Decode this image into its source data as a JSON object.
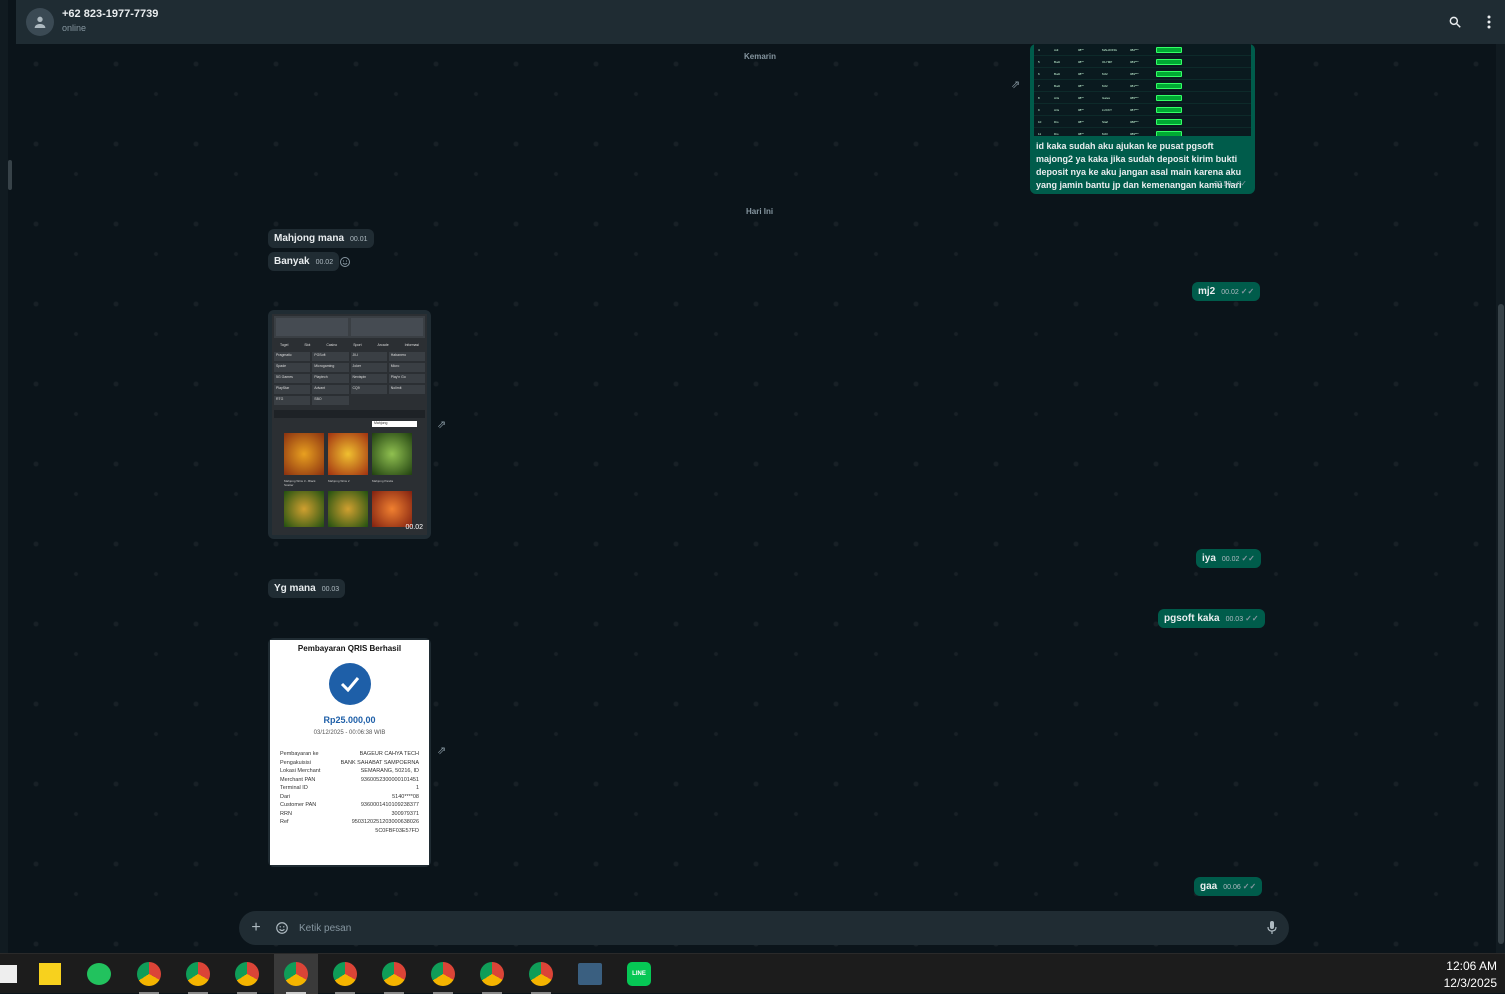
{
  "header": {
    "contact_name": "+62 823-1977-7739",
    "status": "online",
    "search_icon": "search-icon",
    "menu_icon": "kebab-menu-icon"
  },
  "dates": {
    "yesterday": "Kemarin",
    "today": "Hari Ini"
  },
  "messages": {
    "out_caption": {
      "text": "id kaka sudah aku ajukan ke pusat pgsoft majong2 ya kaka jika sudah deposit kirim bukti deposit nya ke aku jangan asal main karena aku yang jamin bantu jp dan kemenangan kamu hari ini",
      "time": "22.59"
    },
    "in1": {
      "text": "Mahjong mana",
      "time": "00.01"
    },
    "in2": {
      "text": "Banyak",
      "time": "00.02"
    },
    "out_mj2": {
      "text": "mj2",
      "time": "00.02"
    },
    "in_img_time": "00.02",
    "out_iya": {
      "text": "iya",
      "time": "00.02"
    },
    "in3": {
      "text": "Yg mana",
      "time": "00.03"
    },
    "out_pgsoft": {
      "text": "pgsoft kaka",
      "time": "00.03"
    },
    "out_gaa": {
      "text": "gaa",
      "time": "00.06"
    }
  },
  "receipt": {
    "title": "Pembayaran QRIS Berhasil",
    "amount": "Rp25.000,00",
    "datetime": "03/12/2025 - 00:06:38 WIB",
    "rows": [
      {
        "k": "Pembayaran ke",
        "v": "BAGEUR CAHYA TECH"
      },
      {
        "k": "Pengakuisisi",
        "v": "BANK SAHABAT SAMPOERNA"
      },
      {
        "k": "Lokasi Merchant",
        "v": "SEMARANG, 50216, ID"
      },
      {
        "k": "Merchant PAN",
        "v": "9360052300000101451"
      },
      {
        "k": "Terminal ID",
        "v": "1"
      },
      {
        "k": "Dari",
        "v": "5140****08"
      },
      {
        "k": "Customer PAN",
        "v": "9360001410109238377"
      },
      {
        "k": "RRN",
        "v": "300979371"
      },
      {
        "k": "Ref",
        "v": "9503120251203000638026"
      },
      {
        "k": "",
        "v": "5C0FBF03E57FD"
      }
    ]
  },
  "game_screenshot": {
    "tabs": [
      "Togel",
      "Slot",
      "Casino",
      "Sport",
      "Arcade",
      "Informasi"
    ],
    "providers": [
      "Pragmatic",
      "PGSoft",
      "JILI",
      "Habanero",
      "Spade",
      "Microgaming",
      "Joker",
      "Micro",
      "5G Games",
      "Playtech",
      "Nextspin",
      "Play'n Go",
      "PlayStar",
      "Advant",
      "CQ9",
      "Nolimit",
      "RTG",
      "SBO"
    ],
    "search_value": "Mahjong",
    "games": [
      "Mahjong Wins 3 - Black Scatter",
      "Mahjong Wins 2",
      "Mahjong Panda"
    ]
  },
  "composer": {
    "placeholder": "Ketik pesan",
    "plus_icon": "plus-icon",
    "emoji_icon": "sticker-icon",
    "mic_icon": "mic-icon"
  },
  "taskbar": {
    "time": "12:06 AM",
    "date": "12/3/2025",
    "apps": [
      "sticky-notes",
      "messages",
      "chrome",
      "chrome",
      "chrome",
      "chrome",
      "chrome",
      "chrome",
      "chrome",
      "chrome",
      "chrome",
      "app",
      "line"
    ]
  },
  "colors": {
    "out_bubble": "#005c4b",
    "in_bubble": "#202c33",
    "bg": "#0b141a",
    "header": "#1f2c33"
  }
}
